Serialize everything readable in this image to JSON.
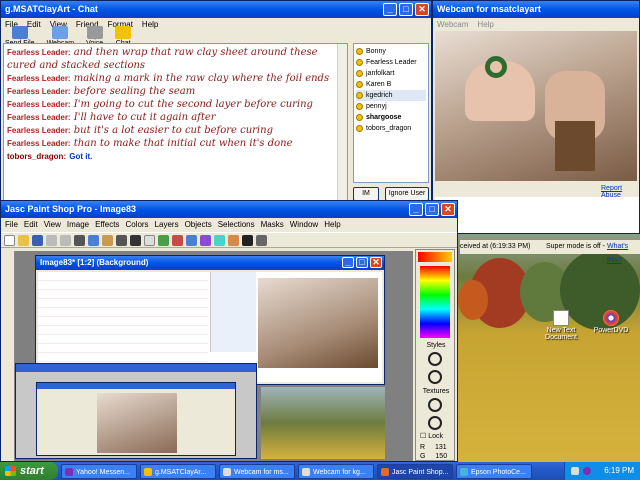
{
  "chat_window": {
    "title": "g.MSATClayArt - Chat",
    "menu": [
      "File",
      "Edit",
      "View",
      "Friend",
      "Format",
      "Help"
    ],
    "actions": [
      "Send File",
      "Webcam",
      "Voice",
      "Chat"
    ],
    "messages": [
      {
        "sender": "Fearless Leader:",
        "text": "and then wrap that raw clay sheet around these cured and stacked sections"
      },
      {
        "sender": "Fearless Leader:",
        "text": "making a mark in the raw clay where the foil ends"
      },
      {
        "sender": "Fearless Leader:",
        "text": "before sealing the seam"
      },
      {
        "sender": "Fearless Leader:",
        "text": "I'm going to cut the second layer before curing"
      },
      {
        "sender": "Fearless Leader:",
        "text": "I'll have to cut it again after"
      },
      {
        "sender": "Fearless Leader:",
        "text": "but it's a lot easier to cut before curing"
      },
      {
        "sender": "Fearless Leader:",
        "text": "than to make that initial cut when it's done"
      },
      {
        "sender": "tobors_dragon:",
        "text": "Got it."
      }
    ],
    "buddies": [
      "Bonny",
      "Fearless Leader",
      "janfolkart",
      "Karen B",
      "kgedrich",
      "pennyj",
      "shargoose",
      "tobors_dragon"
    ],
    "im_button": "IM",
    "ignore_button": "Ignore User"
  },
  "webcam_window": {
    "title": "Webcam for msatclayart",
    "menu": [
      "Webcam",
      "Help"
    ],
    "report_abuse": "Report Abuse",
    "received": "ceived at (6:19:33 PM)",
    "super_mode": "Super mode is off -",
    "whats_this": "What's this?"
  },
  "psp_window": {
    "title": "Jasc Paint Shop Pro - Image83",
    "menu": [
      "File",
      "Edit",
      "View",
      "Image",
      "Effects",
      "Colors",
      "Layers",
      "Objects",
      "Selections",
      "Masks",
      "Window",
      "Help"
    ],
    "image_title": "Image83* [1:2] (Background)",
    "palette": {
      "styles": "Styles",
      "textures": "Textures",
      "lock": "Lock",
      "r_label": "R",
      "r_value": "131",
      "g_label": "G",
      "g_value": "150"
    }
  },
  "desktop": {
    "icons": [
      {
        "label": "New Text Document"
      },
      {
        "label": "PowerDVD"
      }
    ]
  },
  "taskbar": {
    "start": "start",
    "tasks": [
      {
        "label": "Yahoo! Messen...",
        "active": false
      },
      {
        "label": "g.MSATClayAr...",
        "active": false
      },
      {
        "label": "Webcam for ms...",
        "active": false
      },
      {
        "label": "Webcam for kg...",
        "active": false
      },
      {
        "label": "Jasc Paint Shop...",
        "active": true
      },
      {
        "label": "Epson PhotoCe...",
        "active": false
      }
    ],
    "clock": "6:19 PM"
  },
  "colors": {
    "xp_blue": "#0055e5",
    "chat_text": "#8b1a1a",
    "close_red": "#d9461f"
  }
}
